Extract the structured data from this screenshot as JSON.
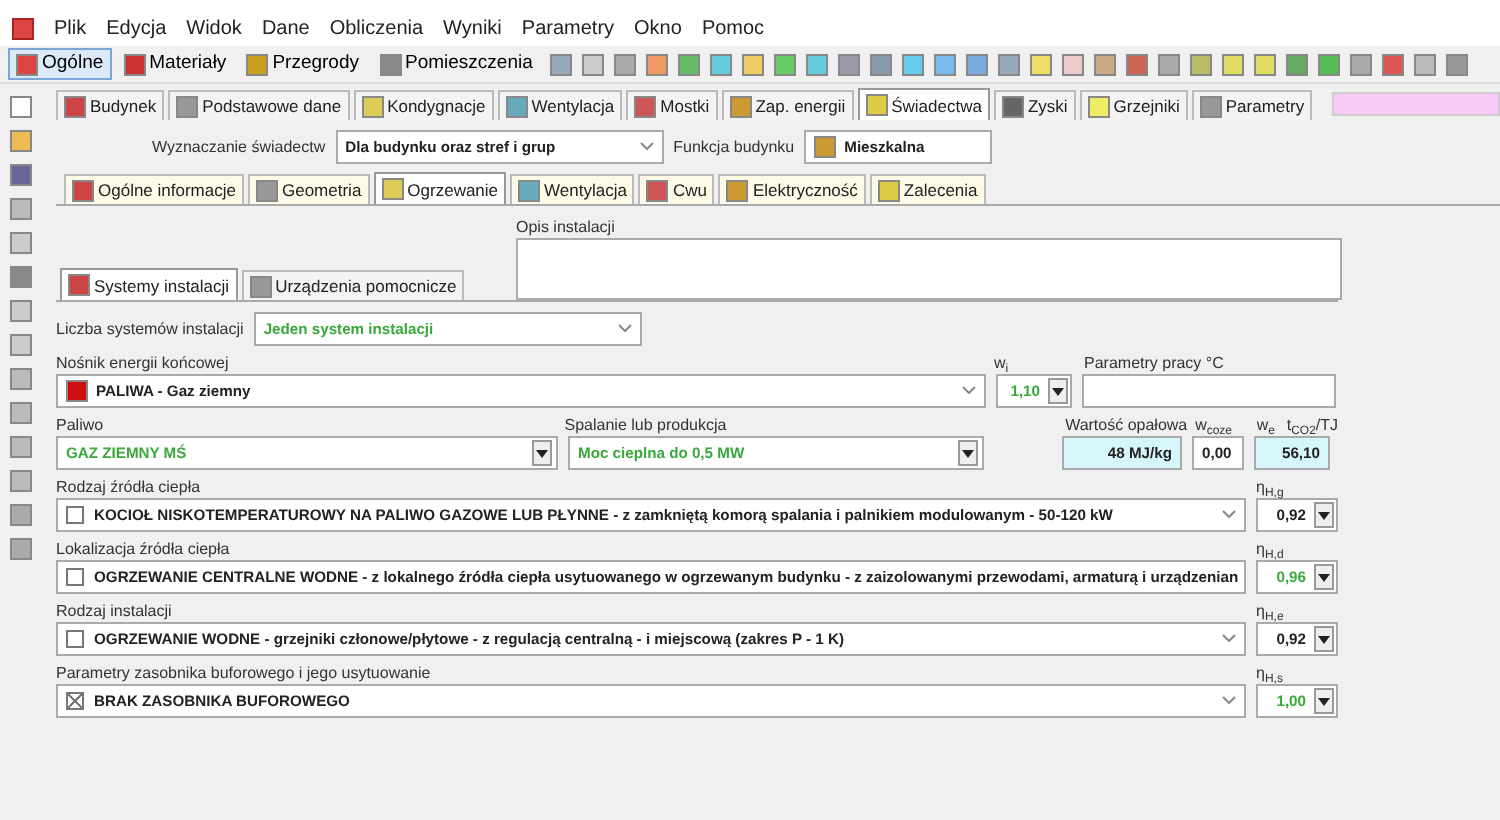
{
  "menu": [
    "Plik",
    "Edycja",
    "Widok",
    "Dane",
    "Obliczenia",
    "Wyniki",
    "Parametry",
    "Okno",
    "Pomoc"
  ],
  "toolbar_buttons": [
    {
      "label": "Ogólne",
      "selected": true
    },
    {
      "label": "Materiały",
      "selected": false
    },
    {
      "label": "Przegrody",
      "selected": false
    },
    {
      "label": "Pomieszczenia",
      "selected": false
    }
  ],
  "main_tabs": [
    {
      "label": "Budynek",
      "selected": false
    },
    {
      "label": "Podstawowe dane",
      "selected": false
    },
    {
      "label": "Kondygnacje",
      "selected": false
    },
    {
      "label": "Wentylacja",
      "selected": false
    },
    {
      "label": "Mostki",
      "selected": false
    },
    {
      "label": "Zap. energii",
      "selected": false
    },
    {
      "label": "Świadectwa",
      "selected": true
    },
    {
      "label": "Zyski",
      "selected": false
    },
    {
      "label": "Grzejniki",
      "selected": false
    },
    {
      "label": "Parametry",
      "selected": false
    }
  ],
  "certificate": {
    "label": "Wyznaczanie świadectw",
    "value": "Dla budynku oraz stref i grup"
  },
  "building_function": {
    "label": "Funkcja budynku",
    "value": "Mieszkalna"
  },
  "section_tabs": [
    {
      "label": "Ogólne informacje",
      "selected": false
    },
    {
      "label": "Geometria",
      "selected": false
    },
    {
      "label": "Ogrzewanie",
      "selected": true
    },
    {
      "label": "Wentylacja",
      "selected": false
    },
    {
      "label": "Cwu",
      "selected": false
    },
    {
      "label": "Elektryczność",
      "selected": false
    },
    {
      "label": "Zalecenia",
      "selected": false
    }
  ],
  "description": {
    "label": "Opis instalacji"
  },
  "sub_tabs": [
    {
      "label": "Systemy instalacji",
      "selected": true
    },
    {
      "label": "Urządzenia pomocnicze",
      "selected": false
    }
  ],
  "system_count": {
    "label": "Liczba systemów instalacji",
    "value": "Jeden system instalacji",
    "auto": true
  },
  "energy_carrier": {
    "label": "Nośnik energii końcowej",
    "value": "PALIWA - Gaz ziemny",
    "auto": false
  },
  "wi": {
    "label": "w$_{i}$",
    "value": "1,10",
    "auto": true
  },
  "work_params": {
    "label": "Parametry pracy  °C"
  },
  "fuel": {
    "label": "Paliwo",
    "value": "GAZ ZIEMNY MŚ",
    "auto": true
  },
  "combustion": {
    "label": "Spalanie lub produkcja",
    "value": "Moc cieplna do 0,5 MW",
    "auto": true
  },
  "calorific": {
    "label": "Wartość opałowa",
    "value": "48 MJ/kg"
  },
  "w_coze": {
    "label": "w$_{coze}$",
    "value": "0,00"
  },
  "emission": {
    "label_w": "w$_{e}$",
    "label_t": "t$_{CO2}$/TJ",
    "value": "56,10"
  },
  "components": [
    {
      "label": "Rodzaj źródła ciepła",
      "value": "KOCIOŁ NISKOTEMPERATUROWY NA PALIWO GAZOWE LUB PŁYNNE -  z zamkniętą komorą spalania i palnikiem modulowanym - 50-120 kW",
      "checked": false,
      "eff_label": "η$_{H,g}$",
      "eff": "0,92",
      "auto": false
    },
    {
      "label": "Lokalizacja źródła ciepła",
      "value": "OGRZEWANIE CENTRALNE WODNE - z lokalnego źródła ciepła usytuowanego w ogrzewanym budynku - z zaizolowanymi przewodami, armaturą i urządzenian",
      "checked": false,
      "eff_label": "η$_{H,d}$",
      "eff": "0,96",
      "auto": true
    },
    {
      "label": "Rodzaj instalacji",
      "value": "OGRZEWANIE WODNE - grzejniki członowe/płytowe - z regulacją centralną - i miejscową (zakres P - 1 K)",
      "checked": false,
      "eff_label": "η$_{H,e}$",
      "eff": "0,92",
      "auto": false
    },
    {
      "label": "Parametry zasobnika buforowego i jego usytuowanie",
      "value": "BRAK ZASOBNIKA BUFOROWEGO",
      "checked": true,
      "eff_label": "η$_{H,s}$",
      "eff": "1,00",
      "auto": true
    }
  ]
}
